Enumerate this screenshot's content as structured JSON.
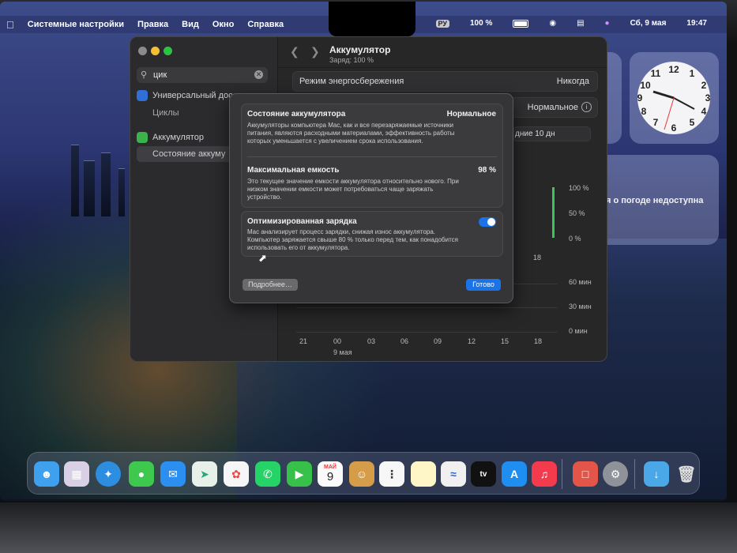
{
  "menubar": {
    "app_name": "Системные настройки",
    "items": [
      "Правка",
      "Вид",
      "Окно",
      "Справка"
    ],
    "input_lang": "РУ",
    "battery_percent": "100 %",
    "datetime": "Сб, 9 мая",
    "clock": "19:47"
  },
  "settings": {
    "search_value": "цик",
    "sidebar": {
      "group1_label": "Универсальный дос",
      "group1_sub": "Циклы",
      "group2_label": "Аккумулятор",
      "group2_sub": "Состояние аккуму"
    },
    "header": {
      "title": "Аккумулятор",
      "subtitle": "Заряд: 100 %"
    },
    "rows": {
      "power_mode_label": "Режим энергосбережения",
      "power_mode_value": "Никогда",
      "health_value": "Нормальное",
      "range_value": "дние 10 дн"
    },
    "chart": {
      "level_ticks": [
        "100 %",
        "50 %",
        "0 %"
      ],
      "level_last_x": "18",
      "usage_ticks": [
        "60 мин",
        "30 мин",
        "0 мин"
      ],
      "x_ticks": [
        "21",
        "00",
        "03",
        "06",
        "09",
        "12",
        "15",
        "18"
      ],
      "x_date": "9 мая"
    }
  },
  "sheet": {
    "card1": {
      "title": "Состояние аккумулятора",
      "value": "Нормальное",
      "desc": "Аккумуляторы компьютера Mac, как и все перезаряжаемые источники питания, являются расходными материалами, эффективность работы которых уменьшается с увеличением срока использования."
    },
    "card2": {
      "title": "Максимальная емкость",
      "value": "98 %",
      "desc": "Это текущее значение емкости аккумулятора относительно нового. При низком значении емкости может потребоваться чаще заряжать устройство."
    },
    "card3": {
      "title": "Оптимизированная зарядка",
      "desc": "Mac анализирует процесс зарядки, снижая износ аккумулятора. Компьютер заряжается свыше 80 % только перед тем, как понадобится использовать его от аккумулятора.",
      "toggle_on": true
    },
    "more_button": "Подробнее…",
    "done_button": "Готово"
  },
  "widgets": {
    "weather_text": "я о погоде недоступна"
  },
  "dock": {
    "calendar_month": "МАЙ",
    "calendar_day": "9",
    "tv_label": "tv"
  },
  "colors": {
    "accent": "#1b73e8",
    "chart_green": "#35c759"
  }
}
